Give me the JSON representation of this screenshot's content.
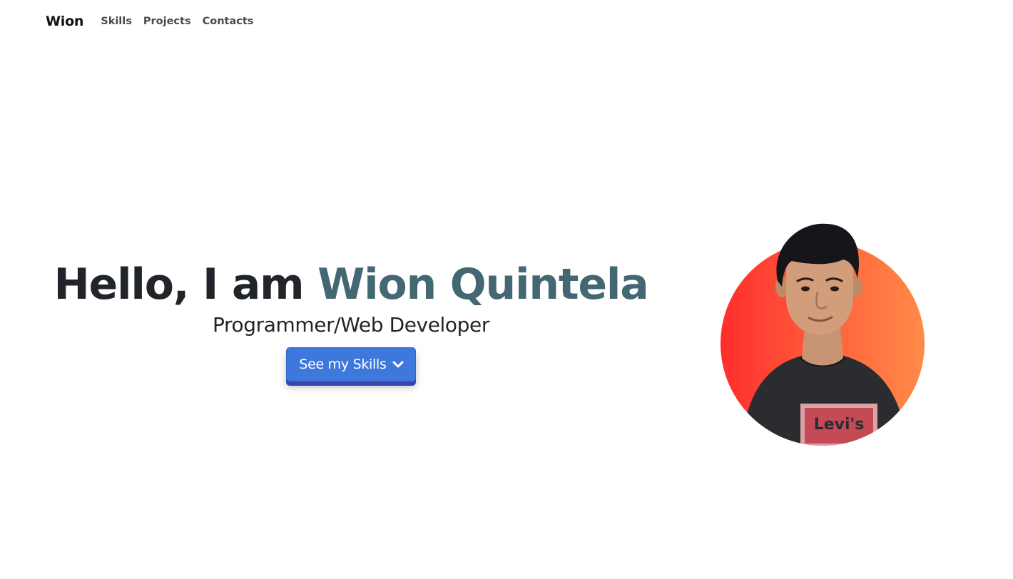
{
  "navbar": {
    "brand": "Wion",
    "links": [
      {
        "label": "Skills"
      },
      {
        "label": "Projects"
      },
      {
        "label": "Contacts"
      }
    ]
  },
  "hero": {
    "greeting": "Hello, I am ",
    "name": "Wion Quintela",
    "subtitle": "Programmer/Web Developer",
    "button_label": "See my Skills",
    "button_icon": "chevron-down-icon"
  },
  "avatar": {
    "shirt_text": "Levi's"
  },
  "colors": {
    "name_accent": "#436773",
    "button": "#3f78dc",
    "button_shadow": "#3a45b0",
    "avatar_gradient_start": "#ff2d2d",
    "avatar_gradient_end": "#ff8a48"
  }
}
